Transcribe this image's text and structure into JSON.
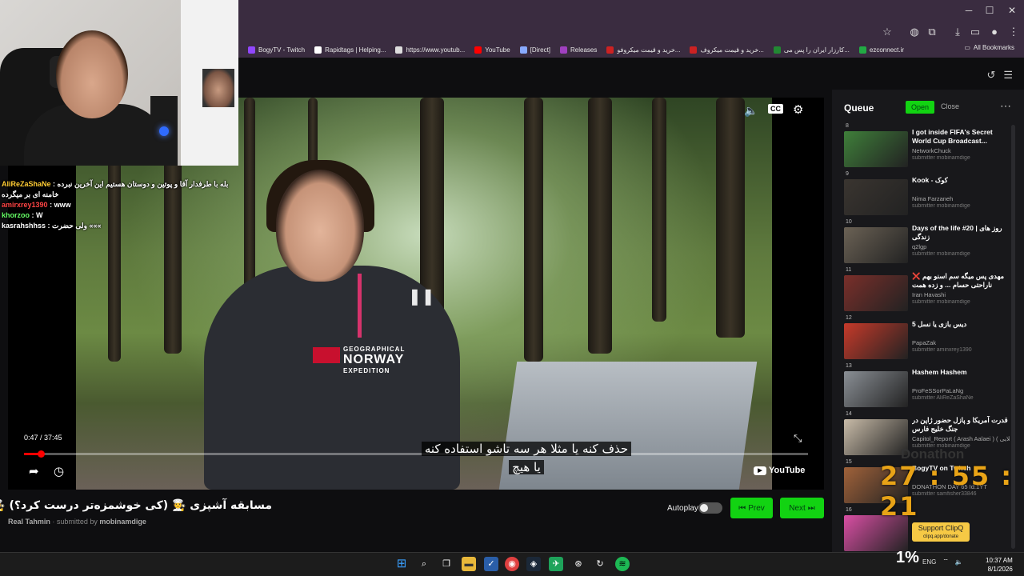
{
  "browser": {
    "bookmarks": [
      {
        "label": "BogyTV - Twitch",
        "color": "#9147ff"
      },
      {
        "label": "Rapidtags | Helping...",
        "color": "#ffffff"
      },
      {
        "label": "https://www.youtub...",
        "color": "#dddddd"
      },
      {
        "label": "YouTube",
        "color": "#ff0000"
      },
      {
        "label": "[Direct]",
        "color": "#88aaff"
      },
      {
        "label": "Releases",
        "color": "#a040c0"
      },
      {
        "label": "خرید و قیمت میکروفو...",
        "color": "#cc2222"
      },
      {
        "label": "خرید و قیمت میکروف...",
        "color": "#cc2222"
      },
      {
        "label": "کارزار ایران را پس می...",
        "color": "#228833"
      },
      {
        "label": "ezconnect.ir",
        "color": "#22aa44"
      }
    ],
    "all_bookmarks": "All Bookmarks"
  },
  "player": {
    "time": "0:47 / 37:45",
    "progress": 0.021,
    "cc_label": "CC",
    "youtube_label": "YouTube",
    "subtitle_line1": "حذف کنه یا مثلا هر سه تاشو استفاده کنه",
    "subtitle_line2": "یا هیچ",
    "jacket_brand_top": "GEOGRAPHICAL",
    "jacket_brand": "NORWAY",
    "jacket_brand_bottom": "EXPEDITION"
  },
  "video": {
    "title": "مسابقه آشپزی 🧑‍🍳 (کی خوشمزه‌تر درست کرد؟) 🧑‍🍳 🔥",
    "channel": "Real Tahmin",
    "submitted_by_label": "submitted by",
    "submitter": "mobinamdige"
  },
  "controls": {
    "autoplay_label": "Autoplay",
    "prev_label": "Prev",
    "next_label": "Next"
  },
  "queue": {
    "title": "Queue",
    "open_label": "Open",
    "close_label": "Close",
    "items": [
      {
        "num": "8",
        "title": "I got inside FIFA's Secret World Cup Broadcast...",
        "channel": "NetworkChuck",
        "submitter": "submitter mobinamdige",
        "thumb": "#3f7f3a"
      },
      {
        "num": "9",
        "title": "Kook - کوک",
        "channel": "Nima Farzaneh",
        "submitter": "submitter mobinamdige",
        "thumb": "#3a3530"
      },
      {
        "num": "10",
        "title": "Days of the life #20 | روز های زندگی",
        "channel": "q2lgp",
        "submitter": "submitter mobinamdige",
        "thumb": "#6b6255"
      },
      {
        "num": "11",
        "title": "مهدی پس میگه سم اسنو بهم ❌ ناراحتی حسام ... و زده همت",
        "channel": "Iran Havashi",
        "submitter": "submitter mobinamdige",
        "thumb": "#7a2f2a"
      },
      {
        "num": "12",
        "title": "دیس بازی یا نسل 5",
        "channel": "PapaZak",
        "submitter": "submitter aminxrey1390",
        "thumb": "#c63a2a"
      },
      {
        "num": "13",
        "title": "Hashem Hashem",
        "channel": "ProFeSSorPaLaNg",
        "submitter": "submitter AliReZaShaNe",
        "thumb": "#8a8f95"
      },
      {
        "num": "14",
        "title": "قدرت آمریکا و پازل حضور ژاپن در جنگ خلیج فارس",
        "channel": "Capitol_Report ( Arash Aalaei ) ( آرش اعلایی )",
        "submitter": "submitter mobinamdige",
        "thumb": "#c8bba8"
      },
      {
        "num": "15",
        "title": "BogyTV on Twitch",
        "channel": "DONATHON DAY 65 Id:1YT",
        "submitter": "submitter samfisher33846",
        "thumb": "#a0623a"
      },
      {
        "num": "16",
        "title": "",
        "channel": "",
        "submitter": "",
        "thumb": "#d94fa4"
      }
    ]
  },
  "stream": {
    "chat": [
      {
        "name": "AliReZaShaNe",
        "name_color": "#ffcc33",
        "msg": "بله با طرفدار آقا و پوتین و دوستان هستیم این آخرین نبرده خامنه ای بر میگرده"
      },
      {
        "name": "amirxrey1390",
        "name_color": "#ff4444",
        "msg": "www"
      },
      {
        "name": "khorzoo",
        "name_color": "#66ff66",
        "msg": "W"
      },
      {
        "name": "kasrahshhss",
        "name_color": "#ffffff",
        "msg": "ولی حضرت «««"
      }
    ],
    "donation_label": "Donathon",
    "countdown": "27 : 55 : 21",
    "clipq_title": "Support ClipQ",
    "clipq_url": "clipq.app/donate",
    "cpu": "1%"
  },
  "taskbar": {
    "lang": "ENG",
    "time": "10:37 AM",
    "date": "8/1/2026"
  }
}
